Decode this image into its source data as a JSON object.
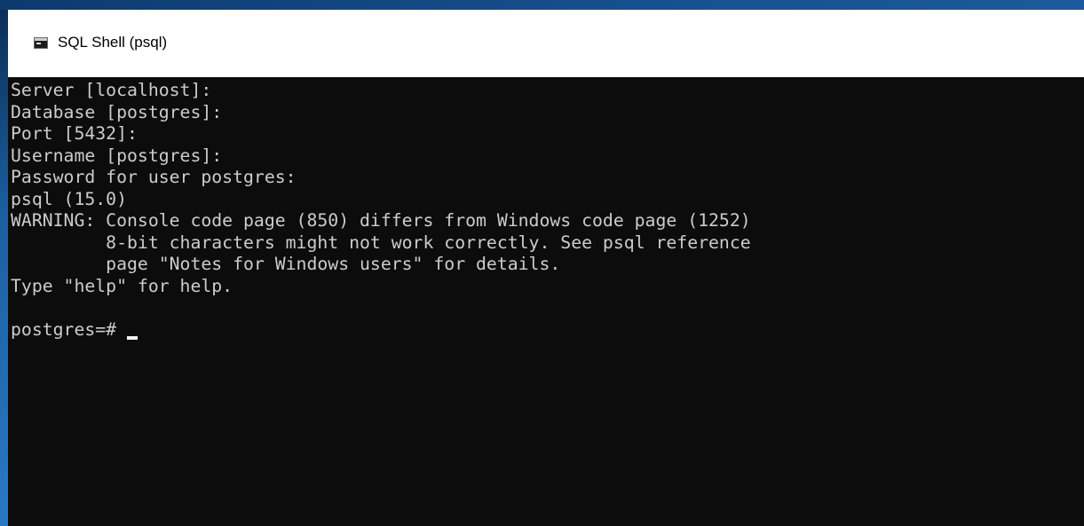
{
  "window": {
    "title": "SQL Shell (psql)",
    "icon": "console-app-icon"
  },
  "console": {
    "lines": [
      "Server [localhost]:",
      "Database [postgres]:",
      "Port [5432]:",
      "Username [postgres]:",
      "Password for user postgres:",
      "psql (15.0)",
      "WARNING: Console code page (850) differs from Windows code page (1252)",
      "         8-bit characters might not work correctly. See psql reference",
      "         page \"Notes for Windows users\" for details.",
      "Type \"help\" for help.",
      ""
    ],
    "prompt": "postgres=# "
  },
  "colors": {
    "console_background": "#0c0c0c",
    "console_text": "#cccccc",
    "title_bar_background": "#ffffff"
  }
}
